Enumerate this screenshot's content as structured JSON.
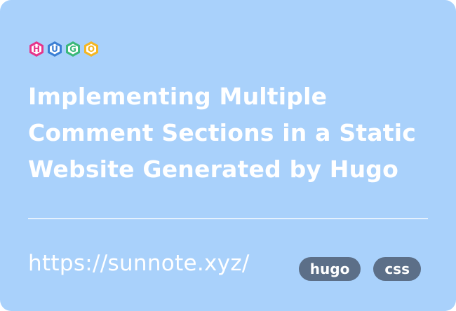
{
  "logo": {
    "letters": [
      {
        "char": "H",
        "color": "#e6358b"
      },
      {
        "char": "U",
        "color": "#3b7fd4"
      },
      {
        "char": "G",
        "color": "#3bb87a"
      },
      {
        "char": "O",
        "color": "#f4b623"
      }
    ]
  },
  "post": {
    "title": "Implementing Multiple Comment Sections in a Static Website Generated by Hugo",
    "url": "https://sunnote.xyz/"
  },
  "tags": [
    "hugo",
    "css"
  ],
  "colors": {
    "card_background": "#a9d1fb",
    "tag_background": "#5c6f88",
    "text": "#ffffff"
  }
}
